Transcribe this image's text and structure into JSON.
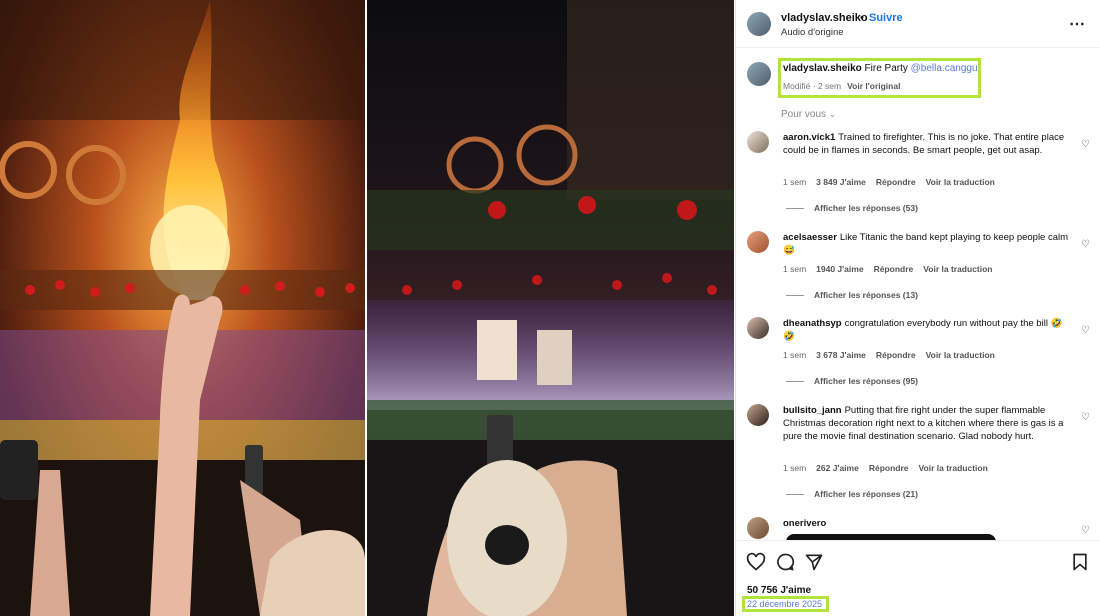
{
  "header": {
    "username": "vladyslav.sheiko",
    "separator": "•",
    "follow_label": "Suivre",
    "audio_label": "Audio d'origine"
  },
  "caption": {
    "username": "vladyslav.sheiko",
    "text": "Fire Party",
    "mention": "@bella.canggu",
    "meta": "Modifié · 2 sem",
    "see_original": "Voir l'original"
  },
  "sort_label": "Pour vous",
  "comments": [
    {
      "username": "aaron.vick1",
      "text": "Trained to firefighter. This is no joke. That entire place could be in flames in seconds. Be smart people, get out asap.",
      "time": "1 sem",
      "likes": "3 849 J'aime",
      "reply": "Répondre",
      "translate": "Voir la traduction",
      "replies": "Afficher les réponses (53)"
    },
    {
      "username": "acelsaesser",
      "text": "Like Titanic the band kept playing to keep people calm 😅",
      "time": "1 sem",
      "likes": "1940 J'aime",
      "reply": "Répondre",
      "translate": "Voir la traduction",
      "replies": "Afficher les réponses (13)"
    },
    {
      "username": "dheanathsyp",
      "text": "congratulation everybody run without pay the bill 🤣🤣",
      "time": "1 sem",
      "likes": "3 678 J'aime",
      "reply": "Répondre",
      "translate": "Voir la traduction",
      "replies": "Afficher les réponses (95)"
    },
    {
      "username": "bullsito_jann",
      "text": "Putting that fire right under the super flammable Christmas decoration right next to a kitchen where there is gas is a pure the movie final destination scenario. Glad nobody hurt.",
      "time": "1 sem",
      "likes": "262 J'aime",
      "reply": "Répondre",
      "translate": "Voir la traduction",
      "replies": "Afficher les réponses (21)"
    },
    {
      "username": "onerivero"
    }
  ],
  "footer": {
    "likes": "50 756 J'aime",
    "date": "22 décembre 2025"
  },
  "colors": {
    "accent_blue": "#1a77e6",
    "highlight_green": "#b4e43c",
    "mention_blue": "#5b7bd5"
  }
}
